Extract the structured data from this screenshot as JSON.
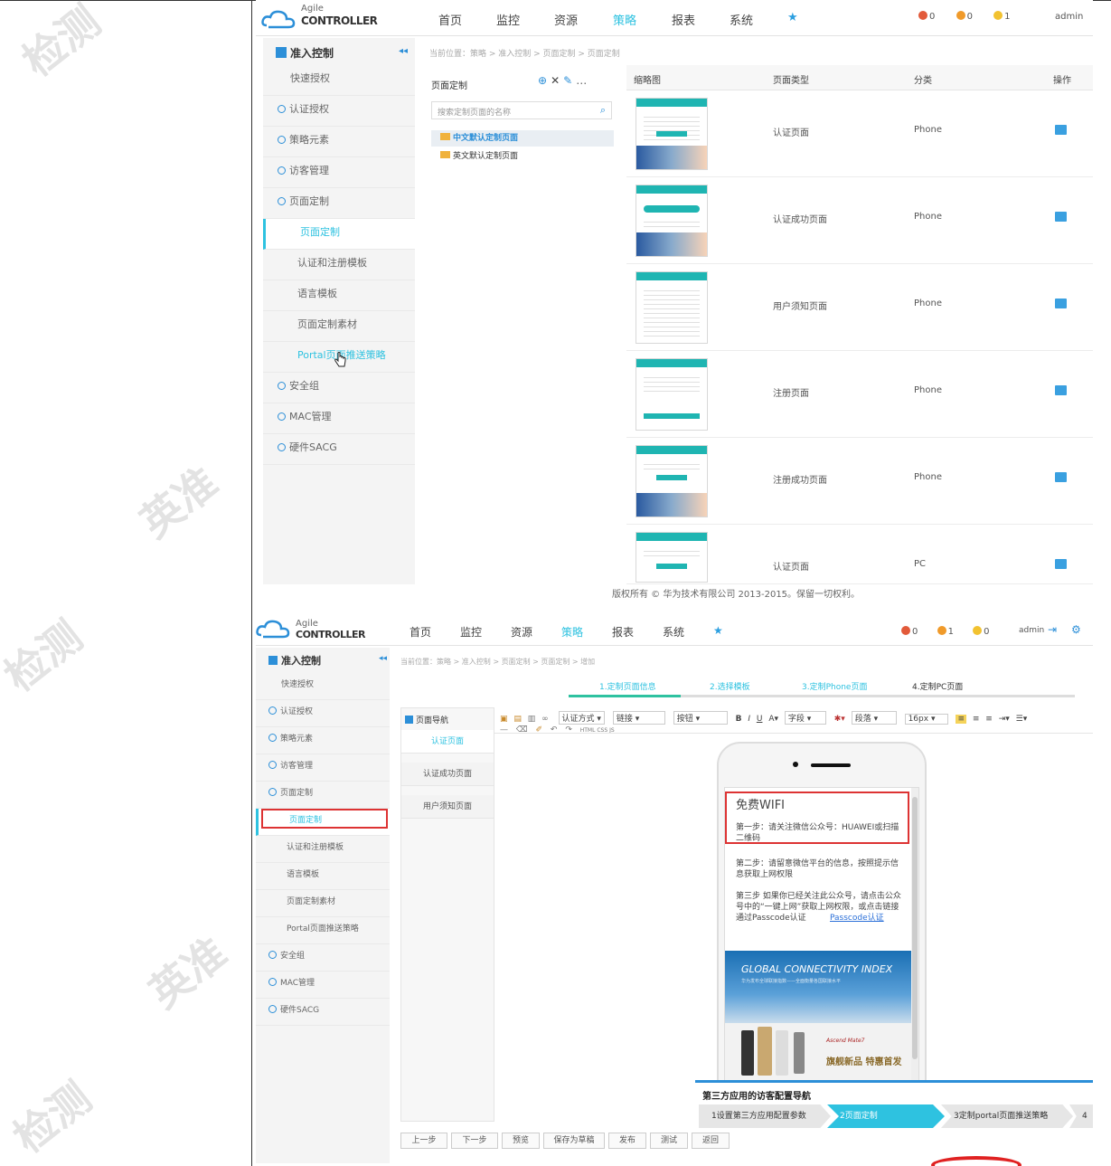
{
  "watermark": [
    "检测",
    "英准",
    "检测",
    "英准",
    "检测"
  ],
  "screen1": {
    "logo": {
      "small": "Agile",
      "big": "CONTROLLER"
    },
    "nav": [
      "首页",
      "监控",
      "资源",
      "策略",
      "报表",
      "系统"
    ],
    "nav_active": "策略",
    "alerts": [
      "0",
      "0",
      "1"
    ],
    "user": "admin",
    "sidebar_title": "准入控制",
    "sidebar_items": [
      "快速授权",
      "认证授权",
      "策略元素",
      "访客管理",
      "页面定制",
      "页面定制",
      "认证和注册模板",
      "语言模板",
      "页面定制素材",
      "Portal页面推送策略",
      "安全组",
      "MAC管理",
      "硬件SACG"
    ],
    "breadcrumb": "当前位置：策略 > 准入控制 > 页面定制 > 页面定制",
    "tree_title": "页面定制",
    "tree_tools": "⊕ ✕ ✎ ...",
    "search_placeholder": "搜索定制页面的名称",
    "tree_items": [
      "中文默认定制页面",
      "英文默认定制页面"
    ],
    "columns": [
      "缩略图",
      "页面类型",
      "分类",
      "操作"
    ],
    "rows": [
      {
        "type": "认证页面",
        "cat": "Phone"
      },
      {
        "type": "认证成功页面",
        "cat": "Phone"
      },
      {
        "type": "用户须知页面",
        "cat": "Phone"
      },
      {
        "type": "注册页面",
        "cat": "Phone"
      },
      {
        "type": "注册成功页面",
        "cat": "Phone"
      },
      {
        "type": "认证页面",
        "cat": "PC"
      }
    ],
    "footer": "版权所有 © 华为技术有限公司 2013-2015。保留一切权利。"
  },
  "screen2": {
    "logo": {
      "small": "Agile",
      "big": "CONTROLLER"
    },
    "nav": [
      "首页",
      "监控",
      "资源",
      "策略",
      "报表",
      "系统"
    ],
    "alerts": [
      "0",
      "1",
      "0"
    ],
    "user": "admin",
    "sidebar_title": "准入控制",
    "sidebar_items": [
      "快速授权",
      "认证授权",
      "策略元素",
      "访客管理",
      "页面定制",
      "页面定制",
      "认证和注册模板",
      "语言模板",
      "页面定制素材",
      "Portal页面推送策略",
      "安全组",
      "MAC管理",
      "硬件SACG"
    ],
    "breadcrumb": "当前位置：策略 > 准入控制 > 页面定制 > 页面定制 > 增加",
    "steps": [
      "1.定制页面信息",
      "2.选择模板",
      "3.定制Phone页面",
      "4.定制PC页面"
    ],
    "toolbar1": [
      "认证方式",
      "链接",
      "按钮",
      "字段",
      "段落",
      "16px"
    ],
    "toolbar2": "HTML CSS JS",
    "page_nav_title": "页面导航",
    "page_nav": [
      "认证页面",
      "认证成功页面",
      "用户须知页面"
    ],
    "phone": {
      "title": "免费WIFI",
      "step1": "第一步：请关注微信公众号：HUAWEI或扫描二维码",
      "step2": "第二步：请留意微信平台的信息，按照提示信息获取上网权限",
      "step3": "第三步 如果你已经关注此公众号，请点击公众号中的“一键上网”获取上网权限，或点击链接通过Passcode认证",
      "link": "Passcode认证",
      "ad_title": "GLOBAL CONNECTIVITY INDEX",
      "ad_sub": "华为发布全球联接指数——全面衡量各国联接水平",
      "ad_product": "Ascend Mate7",
      "ad_slogan": "旗舰新品 特惠首发"
    },
    "wizard_title": "第三方应用的访客配置导航",
    "wizard_steps": [
      "1设置第三方应用配置参数",
      "2页面定制",
      "3定制portal页面推送策略",
      "4"
    ],
    "buttons": [
      "上一步",
      "下一步",
      "预览",
      "保存为草稿",
      "发布",
      "测试",
      "返回"
    ]
  }
}
